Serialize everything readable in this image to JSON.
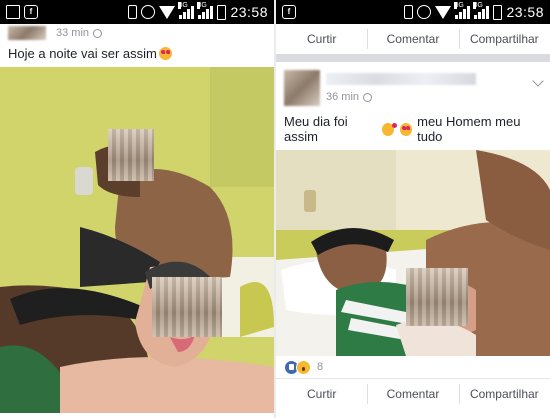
{
  "statusbar": {
    "net_label_1": "3G",
    "net_label_2": "3G",
    "time": "23:58"
  },
  "left": {
    "post": {
      "time": "33 min",
      "text": "Hoje a noite vai ser assim",
      "emoji": "heart-eyes"
    }
  },
  "right": {
    "top_actions": {
      "like": "Curtir",
      "comment": "Comentar",
      "share": "Compartilhar"
    },
    "post": {
      "time": "36 min",
      "text_before": "Meu dia foi assim",
      "emojis": [
        "kiss",
        "heart-eyes"
      ],
      "text_after": "meu Homem meu tudo"
    },
    "reactions": {
      "icons": [
        "like-icon",
        "wow-icon"
      ],
      "count": "8"
    },
    "bottom_actions": {
      "like": "Curtir",
      "comment": "Comentar",
      "share": "Compartilhar"
    }
  },
  "colors": {
    "statusbar": "#000000",
    "text": "#1d2129",
    "meta": "#90949c",
    "action_text": "#4b4f56",
    "like_blue": "#4267b2",
    "wall": "#d3d66a",
    "room": "#ede7c9"
  }
}
